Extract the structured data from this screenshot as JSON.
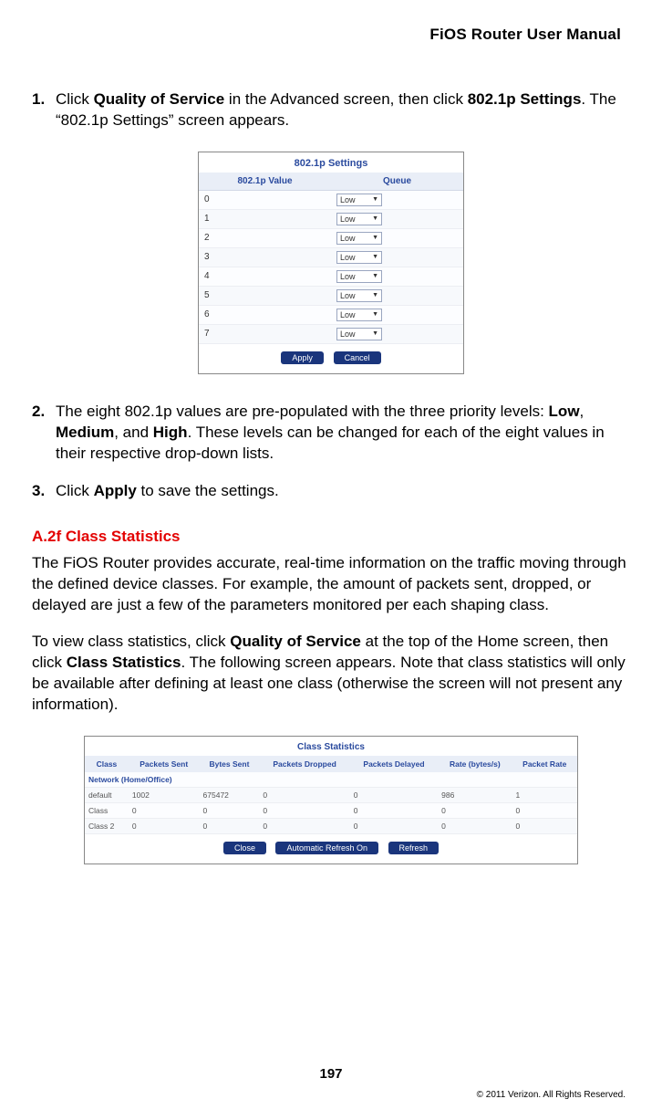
{
  "header": {
    "title": "FiOS Router User Manual"
  },
  "steps": {
    "s1": {
      "num": "1.",
      "pre": "Click ",
      "b1": "Quality of Service",
      "mid": " in the Advanced screen, then click ",
      "b2": "802.1p Settings",
      "post": ". The “802.1p Settings” screen appears."
    },
    "s2": {
      "num": "2.",
      "pre": "The eight 802.1p values are pre-populated with the three priority levels: ",
      "b1": "Low",
      "sep1": ", ",
      "b2": "Medium",
      "sep2": ", and ",
      "b3": "High",
      "post": ". These levels can be changed for each of the eight values in their respective drop-down lists."
    },
    "s3": {
      "num": "3.",
      "pre": "Click ",
      "b1": "Apply",
      "post": " to save the settings."
    }
  },
  "fig802": {
    "title": "802.1p Settings",
    "col_value": "802.1p Value",
    "col_queue": "Queue",
    "rows": [
      {
        "val": "0",
        "queue": "Low"
      },
      {
        "val": "1",
        "queue": "Low"
      },
      {
        "val": "2",
        "queue": "Low"
      },
      {
        "val": "3",
        "queue": "Low"
      },
      {
        "val": "4",
        "queue": "Low"
      },
      {
        "val": "5",
        "queue": "Low"
      },
      {
        "val": "6",
        "queue": "Low"
      },
      {
        "val": "7",
        "queue": "Low"
      }
    ],
    "btn_apply": "Apply",
    "btn_cancel": "Cancel"
  },
  "section": {
    "head": "A.2f  Class Statistics",
    "p1": "The FiOS Router provides accurate, real-time information on the traffic moving through the defined device classes. For example, the amount of packets sent, dropped, or delayed are just a few of the parameters monitored per each shaping class.",
    "p2": {
      "pre": "To view class statistics, click ",
      "b1": "Quality of Service",
      "mid": " at the top of the Home screen, then click ",
      "b2": "Class Statistics",
      "post": ". The following screen appears. Note that class statistics will only be available after defining at least one class (otherwise the screen will not present any information)."
    }
  },
  "figstats": {
    "title": "Class Statistics",
    "cols": {
      "c1": "Class",
      "c2": "Packets Sent",
      "c3": "Bytes Sent",
      "c4": "Packets Dropped",
      "c5": "Packets Delayed",
      "c6": "Rate (bytes/s)",
      "c7": "Packet Rate"
    },
    "netrow": "Network (Home/Office)",
    "rows": [
      {
        "c1": "default",
        "c2": "1002",
        "c3": "675472",
        "c4": "0",
        "c5": "0",
        "c6": "986",
        "c7": "1"
      },
      {
        "c1": "Class",
        "c2": "0",
        "c3": "0",
        "c4": "0",
        "c5": "0",
        "c6": "0",
        "c7": "0"
      },
      {
        "c1": "Class 2",
        "c2": "0",
        "c3": "0",
        "c4": "0",
        "c5": "0",
        "c6": "0",
        "c7": "0"
      }
    ],
    "btn_close": "Close",
    "btn_auto": "Automatic Refresh On",
    "btn_refresh": "Refresh"
  },
  "footer": {
    "page": "197",
    "copy": "© 2011 Verizon. All Rights Reserved."
  }
}
